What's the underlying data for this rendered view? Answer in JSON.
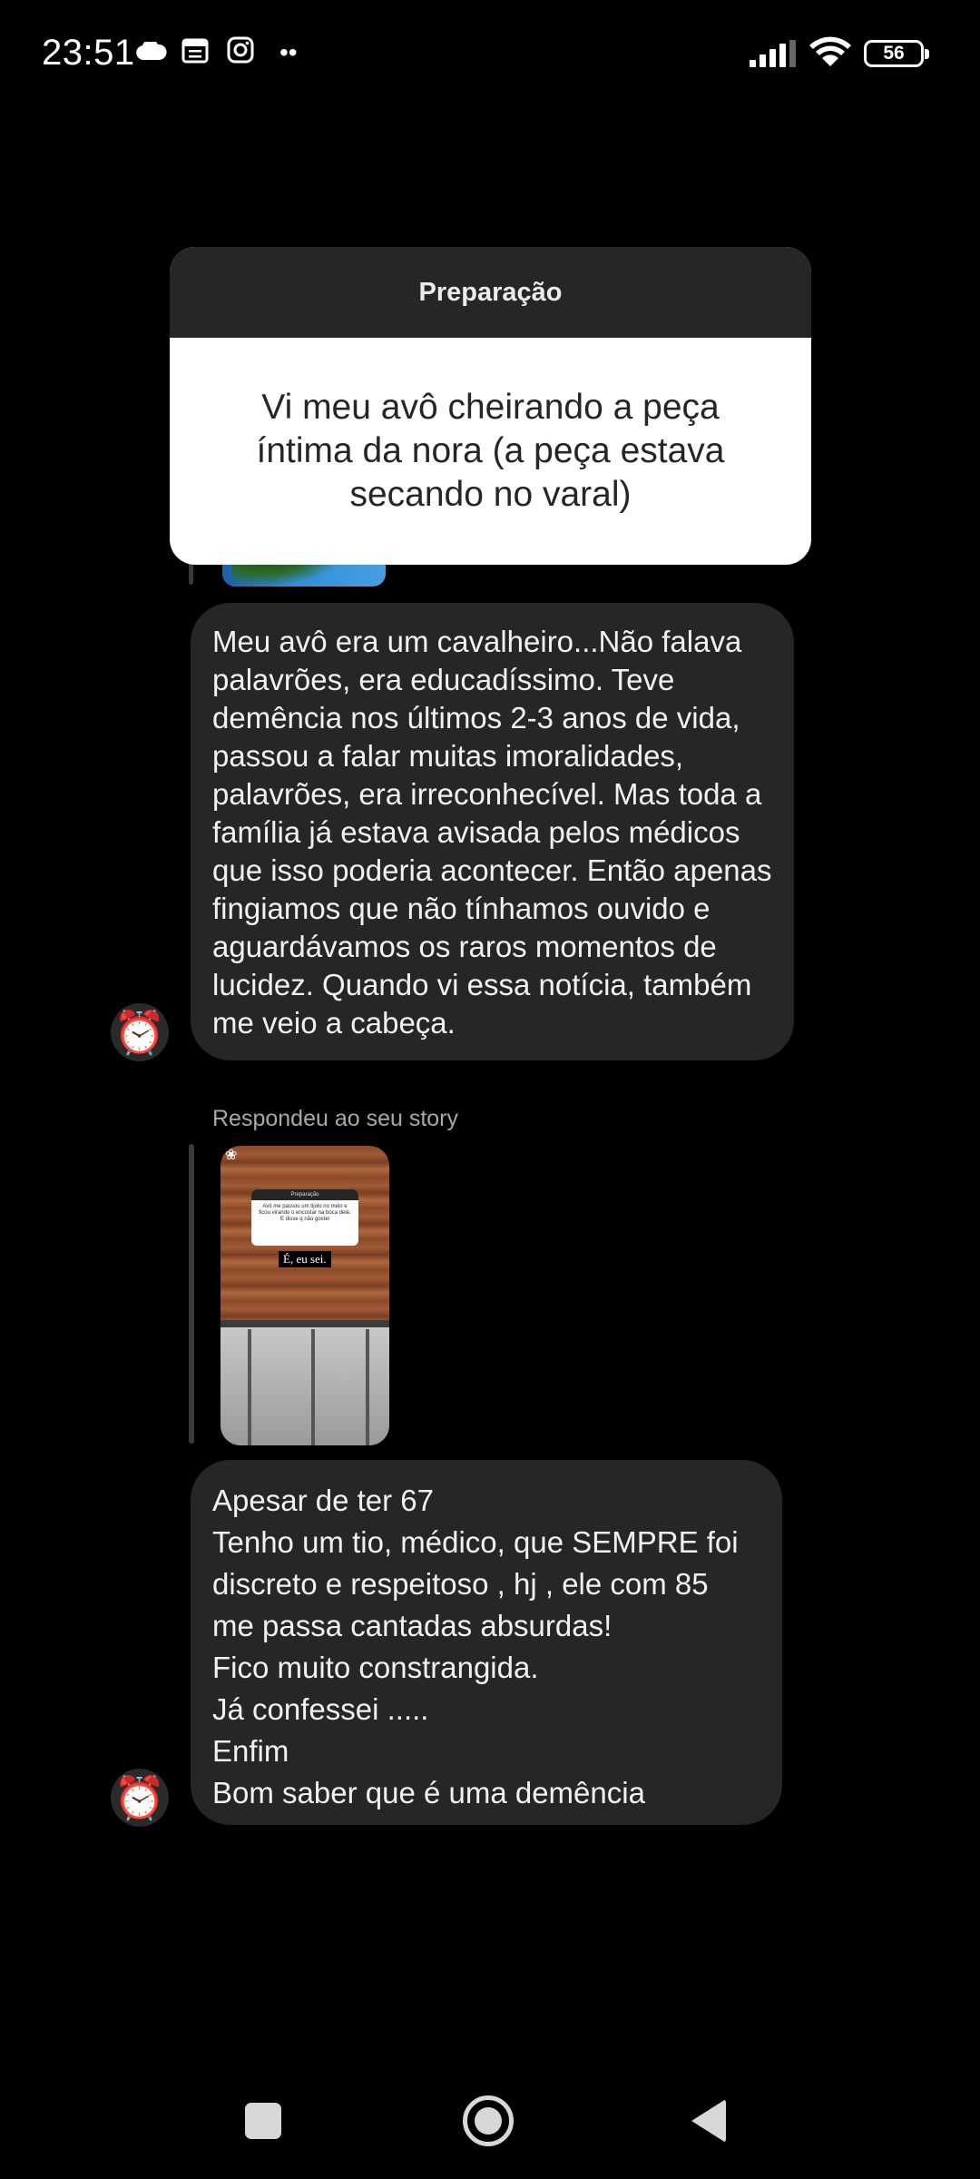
{
  "status_bar": {
    "time": "23:51",
    "battery": "56",
    "icons": [
      "cloud-icon",
      "calendar-icon",
      "instagram-icon",
      "more-dots-icon",
      "signal-icon",
      "wifi-icon",
      "battery-icon"
    ]
  },
  "story_card": {
    "header": "Preparação",
    "question": "Vi meu avô cheirando a peça íntima da nora (a peça estava secando no varal)"
  },
  "messages": [
    {
      "text": "Meu avô era um cavalheiro...Não falava palavrões, era educadíssimo. Teve demência nos últimos 2-3 anos de vida, passou a falar muitas imoralidades, palavrões, era irreconhecível. Mas toda a família já estava avisada pelos médicos que isso poderia acontecer. Então apenas fingiamos que não tínhamos ouvido e aguardávamos os raros momentos de lucidez. Quando vi essa notícia, também me veio a cabeça.",
      "avatar": "⏰"
    },
    {
      "lines": [
        "Apesar de ter 67",
        "Tenho um tio, médico, que SEMPRE foi",
        "discreto e respeitoso , hj , ele com 85",
        "me passa cantadas absurdas!",
        "Fico muito constrangida.",
        "Já confessei .....",
        "Enfim",
        "Bom saber que é uma demência"
      ],
      "avatar": "⏰"
    }
  ],
  "reply_label": "Respondeu ao seu story",
  "story_thumb": {
    "card_header": "Preparação",
    "card_text": "Avô me passou um tijolo no meio e ficou virando o encostar na boca dele. E disse q não gostei",
    "tag": "É, eu sei."
  },
  "nav": {
    "icons": [
      "recents-square-icon",
      "home-circle-icon",
      "back-triangle-icon"
    ]
  }
}
